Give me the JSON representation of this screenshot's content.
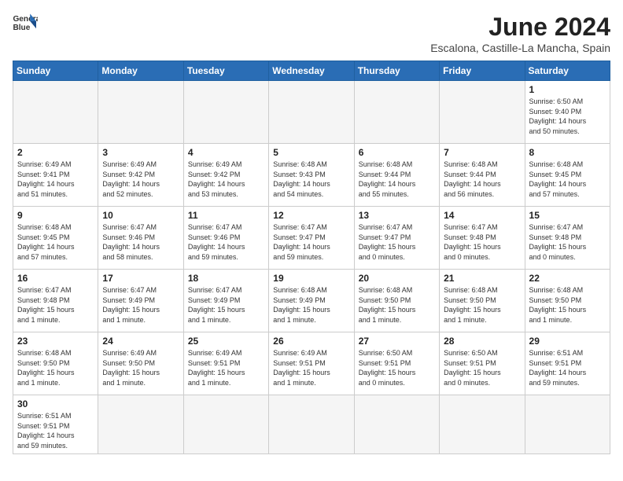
{
  "logo": {
    "line1": "General",
    "line2": "Blue"
  },
  "title": "June 2024",
  "subtitle": "Escalona, Castille-La Mancha, Spain",
  "days_of_week": [
    "Sunday",
    "Monday",
    "Tuesday",
    "Wednesday",
    "Thursday",
    "Friday",
    "Saturday"
  ],
  "weeks": [
    [
      {
        "day": "",
        "info": ""
      },
      {
        "day": "",
        "info": ""
      },
      {
        "day": "",
        "info": ""
      },
      {
        "day": "",
        "info": ""
      },
      {
        "day": "",
        "info": ""
      },
      {
        "day": "",
        "info": ""
      },
      {
        "day": "1",
        "info": "Sunrise: 6:50 AM\nSunset: 9:40 PM\nDaylight: 14 hours\nand 50 minutes."
      }
    ],
    [
      {
        "day": "2",
        "info": "Sunrise: 6:49 AM\nSunset: 9:41 PM\nDaylight: 14 hours\nand 51 minutes."
      },
      {
        "day": "3",
        "info": "Sunrise: 6:49 AM\nSunset: 9:42 PM\nDaylight: 14 hours\nand 52 minutes."
      },
      {
        "day": "4",
        "info": "Sunrise: 6:49 AM\nSunset: 9:42 PM\nDaylight: 14 hours\nand 53 minutes."
      },
      {
        "day": "5",
        "info": "Sunrise: 6:48 AM\nSunset: 9:43 PM\nDaylight: 14 hours\nand 54 minutes."
      },
      {
        "day": "6",
        "info": "Sunrise: 6:48 AM\nSunset: 9:44 PM\nDaylight: 14 hours\nand 55 minutes."
      },
      {
        "day": "7",
        "info": "Sunrise: 6:48 AM\nSunset: 9:44 PM\nDaylight: 14 hours\nand 56 minutes."
      },
      {
        "day": "8",
        "info": "Sunrise: 6:48 AM\nSunset: 9:45 PM\nDaylight: 14 hours\nand 57 minutes."
      }
    ],
    [
      {
        "day": "9",
        "info": "Sunrise: 6:48 AM\nSunset: 9:45 PM\nDaylight: 14 hours\nand 57 minutes."
      },
      {
        "day": "10",
        "info": "Sunrise: 6:47 AM\nSunset: 9:46 PM\nDaylight: 14 hours\nand 58 minutes."
      },
      {
        "day": "11",
        "info": "Sunrise: 6:47 AM\nSunset: 9:46 PM\nDaylight: 14 hours\nand 59 minutes."
      },
      {
        "day": "12",
        "info": "Sunrise: 6:47 AM\nSunset: 9:47 PM\nDaylight: 14 hours\nand 59 minutes."
      },
      {
        "day": "13",
        "info": "Sunrise: 6:47 AM\nSunset: 9:47 PM\nDaylight: 15 hours\nand 0 minutes."
      },
      {
        "day": "14",
        "info": "Sunrise: 6:47 AM\nSunset: 9:48 PM\nDaylight: 15 hours\nand 0 minutes."
      },
      {
        "day": "15",
        "info": "Sunrise: 6:47 AM\nSunset: 9:48 PM\nDaylight: 15 hours\nand 0 minutes."
      }
    ],
    [
      {
        "day": "16",
        "info": "Sunrise: 6:47 AM\nSunset: 9:48 PM\nDaylight: 15 hours\nand 1 minute."
      },
      {
        "day": "17",
        "info": "Sunrise: 6:47 AM\nSunset: 9:49 PM\nDaylight: 15 hours\nand 1 minute."
      },
      {
        "day": "18",
        "info": "Sunrise: 6:47 AM\nSunset: 9:49 PM\nDaylight: 15 hours\nand 1 minute."
      },
      {
        "day": "19",
        "info": "Sunrise: 6:48 AM\nSunset: 9:49 PM\nDaylight: 15 hours\nand 1 minute."
      },
      {
        "day": "20",
        "info": "Sunrise: 6:48 AM\nSunset: 9:50 PM\nDaylight: 15 hours\nand 1 minute."
      },
      {
        "day": "21",
        "info": "Sunrise: 6:48 AM\nSunset: 9:50 PM\nDaylight: 15 hours\nand 1 minute."
      },
      {
        "day": "22",
        "info": "Sunrise: 6:48 AM\nSunset: 9:50 PM\nDaylight: 15 hours\nand 1 minute."
      }
    ],
    [
      {
        "day": "23",
        "info": "Sunrise: 6:48 AM\nSunset: 9:50 PM\nDaylight: 15 hours\nand 1 minute."
      },
      {
        "day": "24",
        "info": "Sunrise: 6:49 AM\nSunset: 9:50 PM\nDaylight: 15 hours\nand 1 minute."
      },
      {
        "day": "25",
        "info": "Sunrise: 6:49 AM\nSunset: 9:51 PM\nDaylight: 15 hours\nand 1 minute."
      },
      {
        "day": "26",
        "info": "Sunrise: 6:49 AM\nSunset: 9:51 PM\nDaylight: 15 hours\nand 1 minute."
      },
      {
        "day": "27",
        "info": "Sunrise: 6:50 AM\nSunset: 9:51 PM\nDaylight: 15 hours\nand 0 minutes."
      },
      {
        "day": "28",
        "info": "Sunrise: 6:50 AM\nSunset: 9:51 PM\nDaylight: 15 hours\nand 0 minutes."
      },
      {
        "day": "29",
        "info": "Sunrise: 6:51 AM\nSunset: 9:51 PM\nDaylight: 14 hours\nand 59 minutes."
      }
    ],
    [
      {
        "day": "30",
        "info": "Sunrise: 6:51 AM\nSunset: 9:51 PM\nDaylight: 14 hours\nand 59 minutes."
      },
      {
        "day": "",
        "info": ""
      },
      {
        "day": "",
        "info": ""
      },
      {
        "day": "",
        "info": ""
      },
      {
        "day": "",
        "info": ""
      },
      {
        "day": "",
        "info": ""
      },
      {
        "day": "",
        "info": ""
      }
    ]
  ]
}
